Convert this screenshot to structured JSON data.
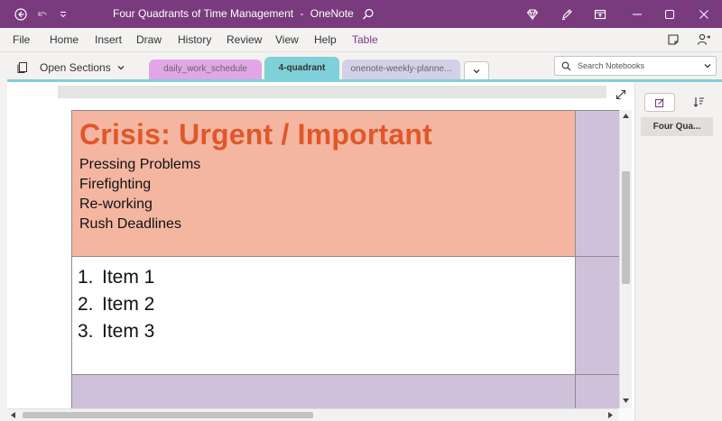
{
  "window": {
    "title": "Four Quadrants of Time Management",
    "separator": "-",
    "app_name": "OneNote"
  },
  "menu": {
    "items": [
      {
        "label": "File"
      },
      {
        "label": "Home"
      },
      {
        "label": "Insert"
      },
      {
        "label": "Draw"
      },
      {
        "label": "History"
      },
      {
        "label": "Review"
      },
      {
        "label": "View"
      },
      {
        "label": "Help"
      },
      {
        "label": "Table",
        "active": true
      }
    ]
  },
  "sections": {
    "open_label": "Open Sections",
    "tabs": [
      {
        "label": "daily_work_schedule",
        "color": "#e2a6e6"
      },
      {
        "label": "4-quadrant",
        "color": "#7fd0d8",
        "active": true
      },
      {
        "label": "onenote-weekly-planne...",
        "color": "#d4d0e8"
      }
    ],
    "search_placeholder": "Search Notebooks"
  },
  "page": {
    "crisis_title": "Crisis: Urgent / Important",
    "crisis_lines": [
      "Pressing Problems",
      "Firefighting",
      "Re-working",
      "Rush Deadlines"
    ],
    "items": [
      {
        "num": "1.",
        "text": "Item 1"
      },
      {
        "num": "2.",
        "text": "Item 2"
      },
      {
        "num": "3.",
        "text": "Item 3"
      }
    ]
  },
  "pages_pane": {
    "pages": [
      {
        "label": "Four Qua..."
      }
    ]
  },
  "colors": {
    "title_bar": "#7a3b7e",
    "crisis_fill": "#f4b6a1",
    "crisis_text": "#e0572b",
    "quadrant_purple": "#d0c1da",
    "section_accent": "#7fd0d8"
  },
  "icons": {
    "titlebar_left": [
      "back-icon",
      "undo-icon",
      "quick-access-dropdown-icon"
    ],
    "titlebar_right": [
      "search-icon",
      "diamond-icon",
      "pen-icon",
      "full-page-view-icon",
      "minimize-icon",
      "maximize-icon",
      "close-icon"
    ],
    "menubar_right": [
      "sticky-notes-icon",
      "share-person-icon"
    ],
    "sections": [
      "notebook-pages-icon",
      "chevron-down-icon"
    ],
    "page": [
      "expand-icon",
      "add-page-icon",
      "sort-icon"
    ]
  }
}
